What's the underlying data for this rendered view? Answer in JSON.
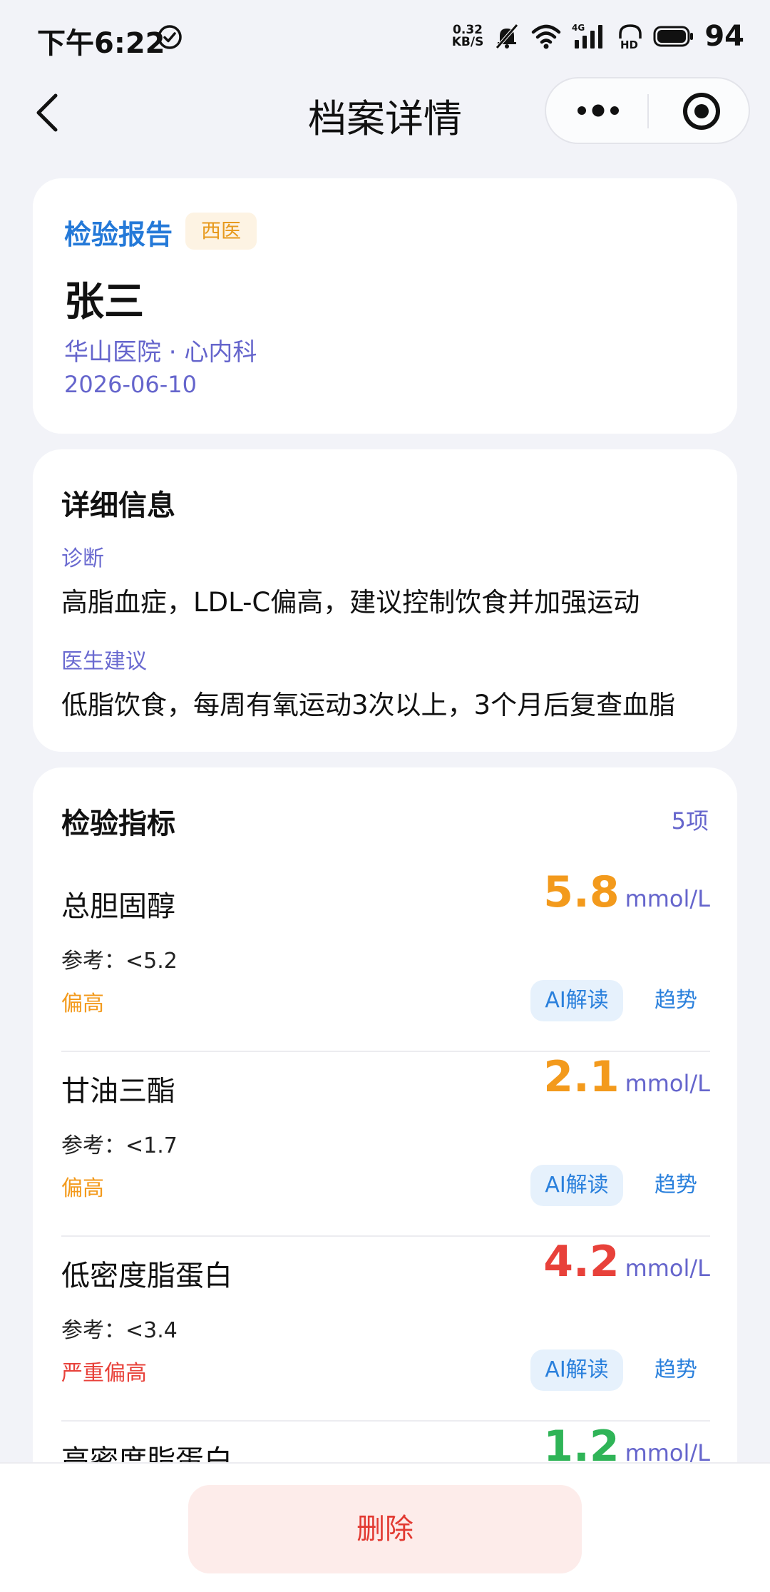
{
  "status_bar": {
    "time": "下午6:22",
    "speed_value": "0.32",
    "speed_unit": "KB/S",
    "network": "4G",
    "battery": "94",
    "icons": [
      "check-circle-icon",
      "mute-bell-icon",
      "wifi-icon",
      "signal-icon",
      "hd-icon",
      "battery-icon"
    ]
  },
  "nav": {
    "title": "档案详情",
    "icons": [
      "back-icon",
      "more-icon",
      "target-icon"
    ]
  },
  "record": {
    "type_label": "检验报告",
    "category_tag": "西医",
    "patient_name": "张三",
    "hospital_dept": "华山医院 · 心内科",
    "date": "2026-06-10"
  },
  "detail": {
    "section_title": "详细信息",
    "diagnosis_label": "诊断",
    "diagnosis_value": "高脂血症，LDL-C偏高，建议控制饮食并加强运动",
    "advice_label": "医生建议",
    "advice_value": "低脂饮食，每周有氧运动3次以上，3个月后复查血脂"
  },
  "indicators": {
    "section_title": "检验指标",
    "count": "5项",
    "ai_label": "AI解读",
    "trend_label": "趋势",
    "items": [
      {
        "name": "总胆固醇",
        "value": "5.8",
        "unit": "mmol/L",
        "reference": "参考：<5.2",
        "status": "偏高",
        "color": "#f39a1c"
      },
      {
        "name": "甘油三酯",
        "value": "2.1",
        "unit": "mmol/L",
        "reference": "参考：<1.7",
        "status": "偏高",
        "color": "#f39a1c"
      },
      {
        "name": "低密度脂蛋白",
        "value": "4.2",
        "unit": "mmol/L",
        "reference": "参考：<3.4",
        "status": "严重偏高",
        "color": "#e8413a"
      },
      {
        "name": "高密度脂蛋白",
        "value": "1.2",
        "unit": "mmol/L",
        "reference": "",
        "status": "",
        "color": "#2fb457"
      }
    ]
  },
  "bottom": {
    "delete_label": "删除"
  },
  "colors": {
    "accent_blue": "#2479d8",
    "label_purple": "#6565cc",
    "warning_orange": "#f39a1c",
    "danger_red": "#e8413a",
    "normal_green": "#2fb457",
    "page_bg": "#f2f3f8"
  }
}
